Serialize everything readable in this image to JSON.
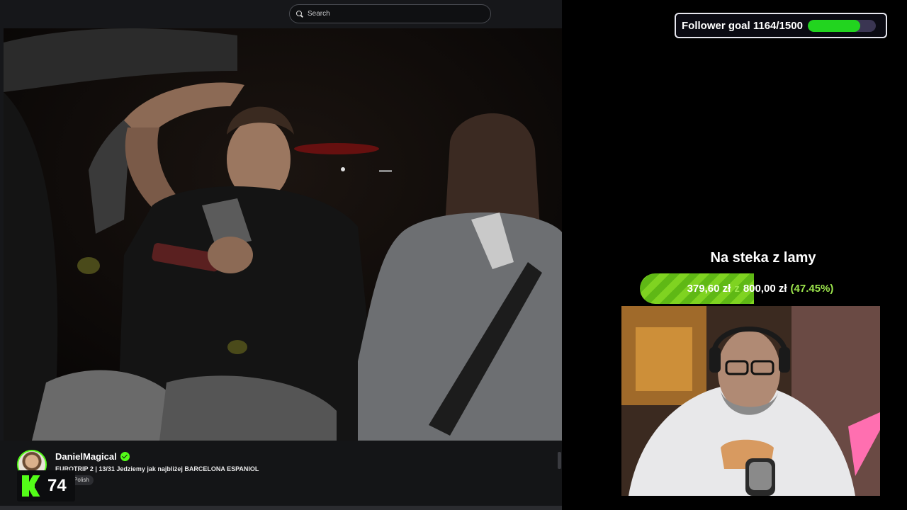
{
  "search": {
    "placeholder": "Search"
  },
  "stream": {
    "channel": "DanielMagical",
    "title": "EUROTRIP 2 | 13/31 Jedziemy jak najbliżej BARCELONA ESPANIOL",
    "language": "Polish",
    "viewers": "74"
  },
  "follower_goal": {
    "label": "Follower goal 1164/1500",
    "current": 1164,
    "target": 1500
  },
  "donation_goal": {
    "title": "Na steka z lamy",
    "current": "379,60 zł",
    "separator": "z",
    "target": "800,00 zł",
    "percent_text": "(47.45%)",
    "percent": 47.45
  },
  "colors": {
    "brand_green": "#53fc18",
    "goal_green": "#22d41f",
    "donation_green": "#7fd321"
  },
  "icons": [
    "search-icon",
    "verified-icon",
    "kick-logo-icon"
  ]
}
